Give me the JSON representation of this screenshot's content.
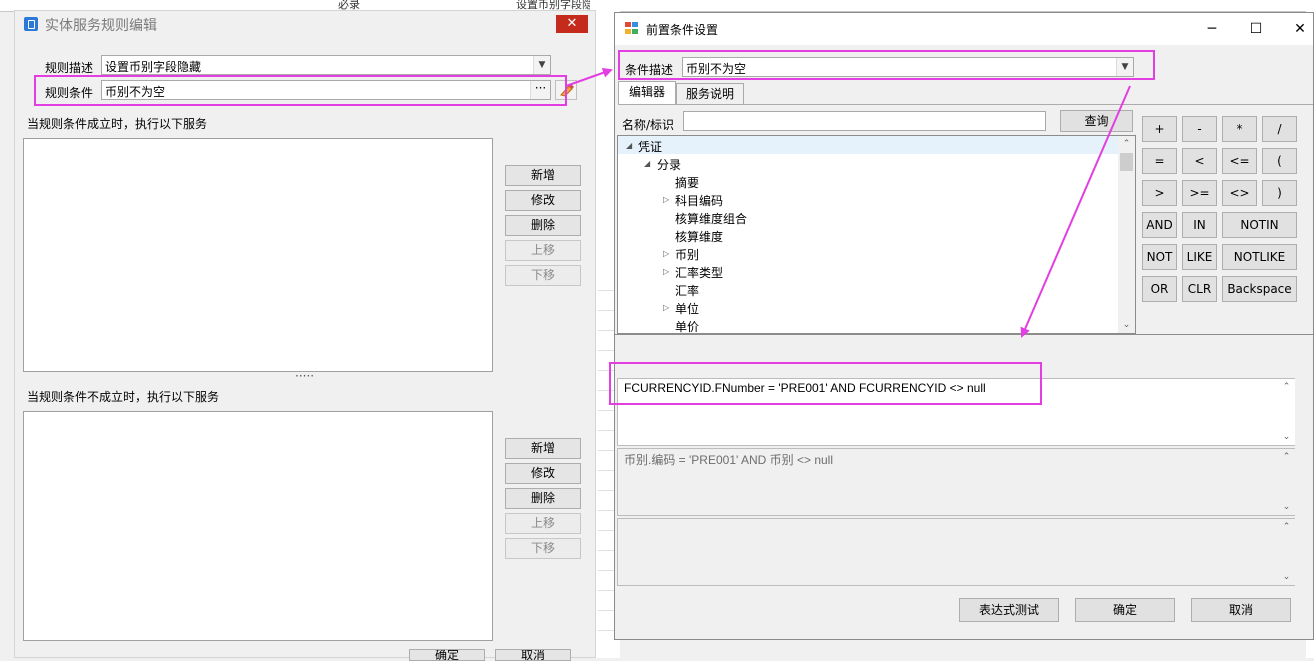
{
  "background": {
    "fragment_left": "必录",
    "fragment_right": "设置币别字段隐藏"
  },
  "left_dialog": {
    "title": "实体服务规则编辑",
    "close_glyph": "✕",
    "rule_desc_label": "规则描述",
    "rule_desc_value": "设置币别字段隐藏",
    "rule_cond_label": "规则条件",
    "rule_cond_value": "币别不为空",
    "ellipsis": "···",
    "true_section_label": "当规则条件成立时，执行以下服务",
    "false_section_label": "当规则条件不成立时，执行以下服务",
    "splitter": "·····",
    "buttons": [
      "新增",
      "修改",
      "删除",
      "上移",
      "下移"
    ],
    "ok_label": "确定",
    "cancel_label": "取消"
  },
  "right_dialog": {
    "title": "前置条件设置",
    "minimize_glyph": "─",
    "maximize_glyph": "☐",
    "close_glyph": "✕",
    "cond_desc_label": "条件描述",
    "cond_desc_value": "币别不为空",
    "tabs": [
      "编辑器",
      "服务说明"
    ],
    "name_label": "名称/标识",
    "name_value": "",
    "query_button": "查询",
    "tree": [
      {
        "label": "凭证",
        "expander": "◢"
      },
      {
        "label": "分录",
        "expander": "◢"
      },
      {
        "label": "摘要",
        "expander": ""
      },
      {
        "label": "科目编码",
        "expander": "▷"
      },
      {
        "label": "核算维度组合",
        "expander": ""
      },
      {
        "label": "核算维度",
        "expander": ""
      },
      {
        "label": "币别",
        "expander": "▷"
      },
      {
        "label": "汇率类型",
        "expander": "▷"
      },
      {
        "label": "汇率",
        "expander": ""
      },
      {
        "label": "单位",
        "expander": "▷"
      },
      {
        "label": "单价",
        "expander": ""
      }
    ],
    "keypad": [
      [
        "+",
        "-",
        "*",
        "/"
      ],
      [
        "=",
        "<",
        "<=",
        "("
      ],
      [
        ">",
        ">=",
        "<>",
        ")"
      ],
      [
        "AND",
        "IN",
        "NOTIN"
      ],
      [
        "NOT",
        "LIKE",
        "NOTLIKE"
      ],
      [
        "OR",
        "CLR",
        "Backspace"
      ]
    ],
    "expression": "FCURRENCYID.FNumber  = 'PRE001' AND  FCURRENCYID  <> null",
    "expression_display": "币别.编码  = 'PRE001' AND  币别  <> null",
    "message": "",
    "test_button": "表达式测试",
    "ok_button": "确定",
    "cancel_button": "取消"
  },
  "colors": {
    "highlight": "#e23ee2",
    "close_red": "#c42b1c",
    "app_icon_blue": "#2b7bd6"
  }
}
